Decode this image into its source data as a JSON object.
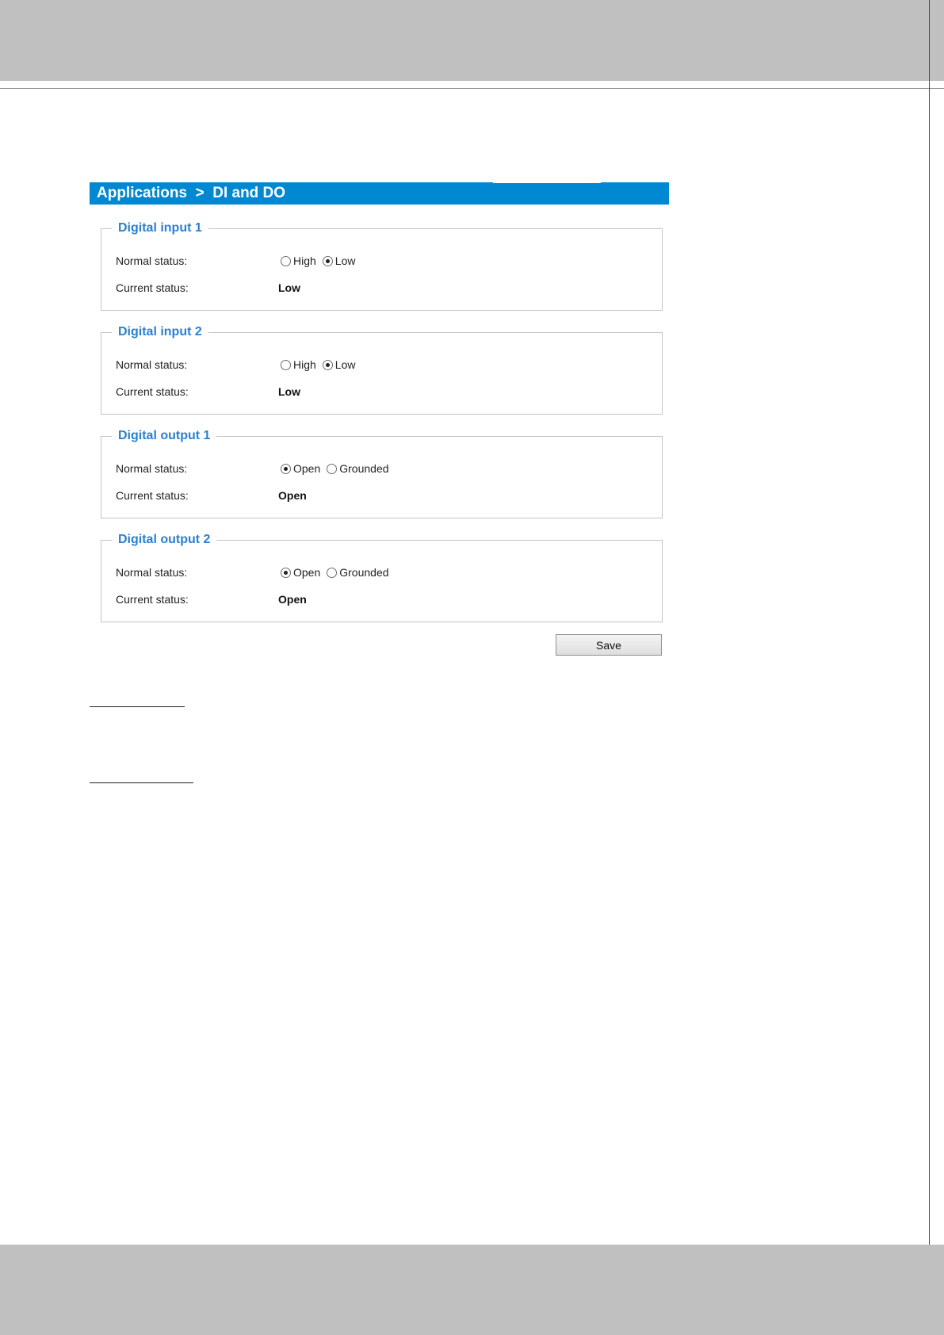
{
  "header": {
    "title": "Applications  >  DI and DO"
  },
  "groups": [
    {
      "legend": "Digital input 1",
      "normal_label": "Normal status:",
      "current_label": "Current status:",
      "options": [
        {
          "label": "High",
          "checked": false
        },
        {
          "label": "Low",
          "checked": true
        }
      ],
      "current_value": "Low"
    },
    {
      "legend": "Digital input 2",
      "normal_label": "Normal status:",
      "current_label": "Current status:",
      "options": [
        {
          "label": "High",
          "checked": false
        },
        {
          "label": "Low",
          "checked": true
        }
      ],
      "current_value": "Low"
    },
    {
      "legend": "Digital output 1",
      "normal_label": "Normal status:",
      "current_label": "Current status:",
      "options": [
        {
          "label": "Open",
          "checked": true
        },
        {
          "label": "Grounded",
          "checked": false
        }
      ],
      "current_value": "Open"
    },
    {
      "legend": "Digital output 2",
      "normal_label": "Normal status:",
      "current_label": "Current status:",
      "options": [
        {
          "label": "Open",
          "checked": true
        },
        {
          "label": "Grounded",
          "checked": false
        }
      ],
      "current_value": "Open"
    }
  ],
  "actions": {
    "save_label": "Save"
  },
  "colors": {
    "title_bar": "#0188d2",
    "legend_text": "#2a7fd0",
    "band": "#c0c0c0"
  }
}
